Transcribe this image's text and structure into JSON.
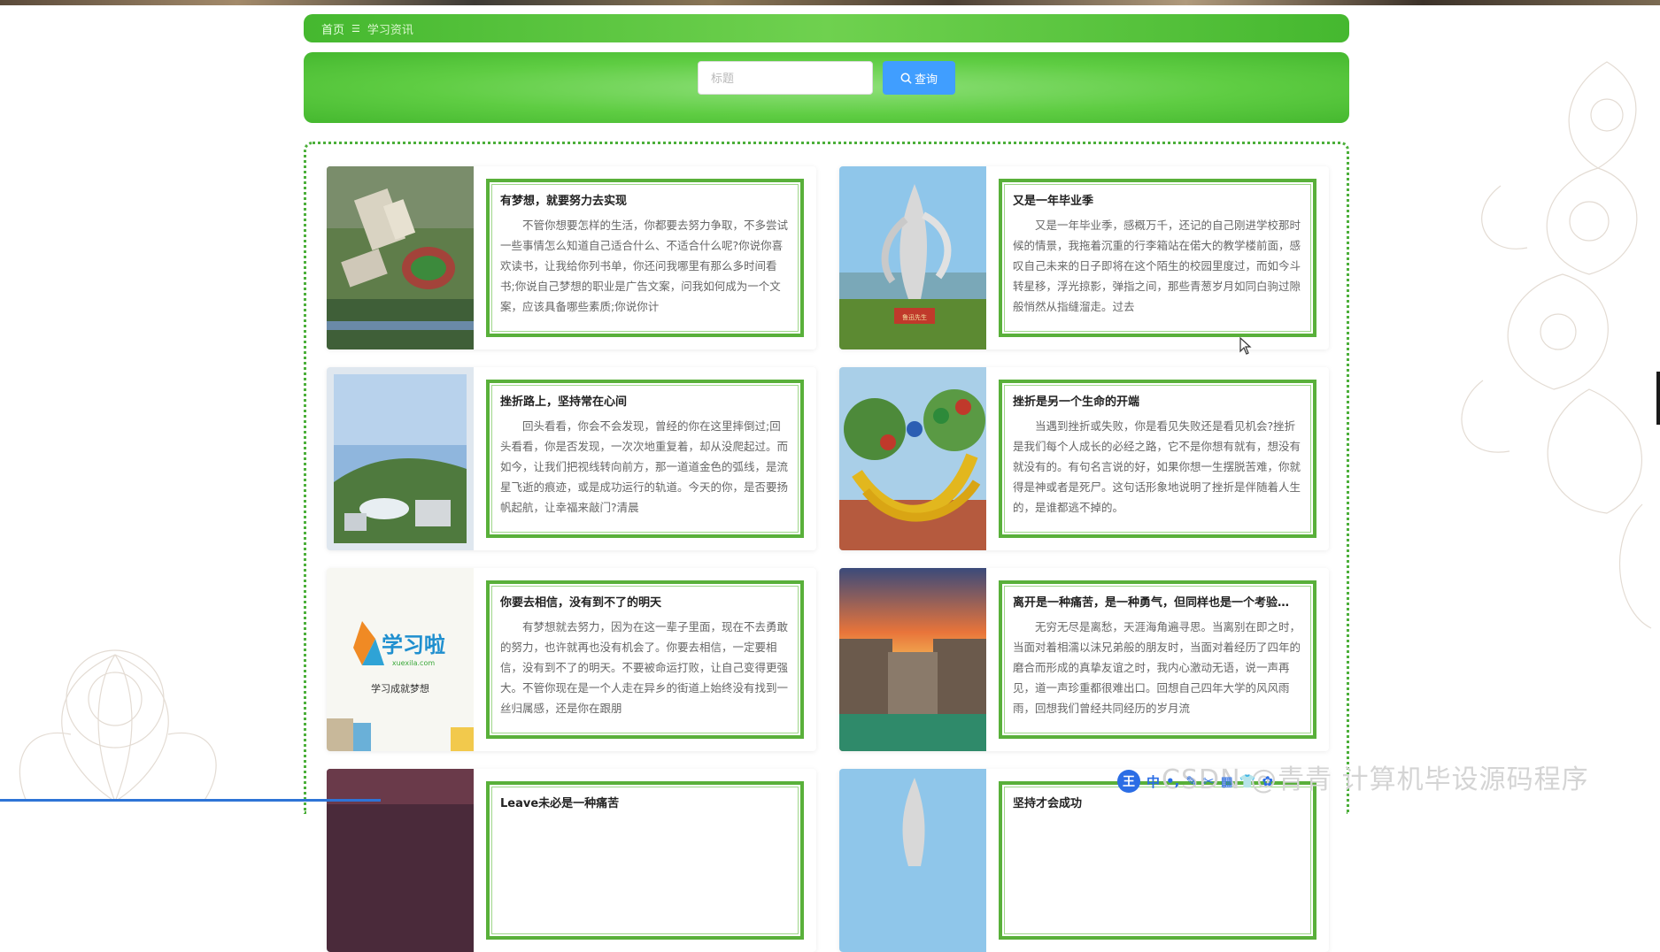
{
  "breadcrumb": {
    "home": "首页",
    "separator": "☰",
    "current": "学习资讯"
  },
  "search": {
    "placeholder": "标题",
    "value": "",
    "button_label": "查询"
  },
  "articles": [
    {
      "title": "有梦想，就要努力去实现",
      "excerpt": "不管你想要怎样的生活，你都要去努力争取，不多尝试一些事情怎么知道自己适合什么、不适合什么呢?你说你喜欢读书，让我给你列书单，你还问我哪里有那么多时间看书;你说自己梦想的职业是广告文案，问我如何成为一个文案，应该具备哪些素质;你说你计"
    },
    {
      "title": "又是一年毕业季",
      "excerpt": "又是一年毕业季，感概万千，还记的自己刚进学校那时候的情景，我拖着沉重的行李箱站在偌大的教学楼前面，感叹自己未来的日子即将在这个陌生的校园里度过，而如今斗转星移，浮光掠影，弹指之间，那些青葱岁月如同白驹过隙般悄然从指缝溜走。过去"
    },
    {
      "title": "挫折路上，坚持常在心间",
      "excerpt": "回头看看，你会不会发现，曾经的你在这里摔倒过;回头看看，你是否发现，一次次地重复着，却从没爬起过。而如今，让我们把视线转向前方，那一道道金色的弧线，是流星飞逝的痕迹，或是成功运行的轨道。今天的你，是否要扬帆起航，让幸福来敲门?清晨"
    },
    {
      "title": "挫折是另一个生命的开端",
      "excerpt": "当遇到挫折或失败，你是看见失败还是看见机会?挫折是我们每个人成长的必经之路，它不是你想有就有，想没有就没有的。有句名言说的好，如果你想一生摆脱苦难，你就得是神或者是死尸。这句话形象地说明了挫折是伴随着人生的，是谁都逃不掉的。"
    },
    {
      "title": "你要去相信，没有到不了的明天",
      "excerpt": "有梦想就去努力，因为在这一辈子里面，现在不去勇敢的努力，也许就再也没有机会了。你要去相信，一定要相信，没有到不了的明天。不要被命运打败，让自己变得更强大。不管你现在是一个人走在异乡的街道上始终没有找到一丝归属感，还是你在跟朋"
    },
    {
      "title": "离开是一种痛苦，是一种勇气，但同样也是一个考验…",
      "excerpt": "无穷无尽是离愁，天涯海角遍寻思。当离别在即之时，当面对着相濡以沫兄弟般的朋友时，当面对着经历了四年的磨合而形成的真挚友谊之时，我内心激动无语，说一声再见，道一声珍重都很难出口。回想自己四年大学的风风雨雨，回想我们曾经共同经历的岁月流"
    },
    {
      "title": "Leave未必是一种痛苦",
      "excerpt": ""
    },
    {
      "title": "坚持才会成功",
      "excerpt": ""
    }
  ],
  "thumb_texts": {
    "logo_main": "学习啦",
    "logo_domain": "xuexila.com",
    "logo_slogan": "学习成就梦想",
    "sculpture_plaque": "鲁迅先生"
  },
  "watermark": {
    "text": "CSDN @青青 计算机毕设源码程序"
  },
  "ime_toolbar": {
    "logo": "王",
    "items": [
      "中",
      "•,",
      "✎",
      "✂",
      "▦",
      "👕",
      "✿"
    ]
  },
  "colors": {
    "accent_green": "#45b82f",
    "button_blue": "#409eff",
    "frame_green": "#59b03a"
  }
}
